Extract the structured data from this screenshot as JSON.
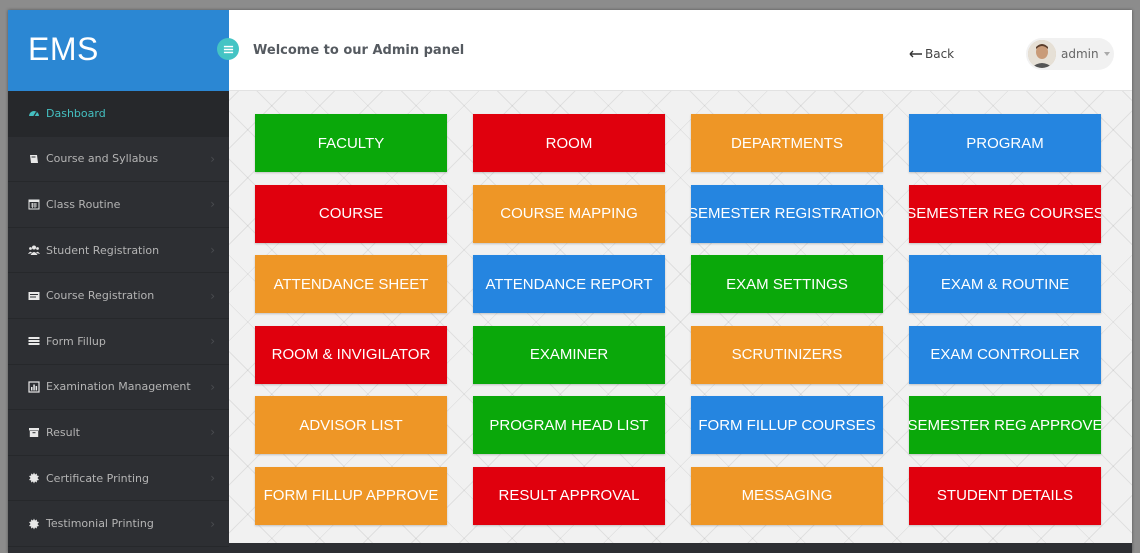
{
  "brand": "EMS",
  "header": {
    "welcome": "Welcome to our Admin panel",
    "back_label": "Back",
    "user_name": "admin"
  },
  "sidebar": {
    "items": [
      {
        "label": "Dashboard",
        "icon": "dashboard-icon",
        "active": true
      },
      {
        "label": "Course and Syllabus",
        "icon": "book-icon"
      },
      {
        "label": "Class Routine",
        "icon": "calendar-icon"
      },
      {
        "label": "Student Registration",
        "icon": "users-icon"
      },
      {
        "label": "Course Registration",
        "icon": "id-card-icon"
      },
      {
        "label": "Form Fillup",
        "icon": "list-icon"
      },
      {
        "label": "Examination Management",
        "icon": "bar-chart-icon"
      },
      {
        "label": "Result",
        "icon": "archive-icon"
      },
      {
        "label": "Certificate Printing",
        "icon": "certificate-icon"
      },
      {
        "label": "Testimonial Printing",
        "icon": "certificate-icon"
      }
    ]
  },
  "colors": {
    "green": "#0aa80a",
    "red": "#e0000d",
    "orange": "#ee9626",
    "blue": "#2585e0"
  },
  "tiles": [
    {
      "label": "FACULTY",
      "color": "green"
    },
    {
      "label": "ROOM",
      "color": "red"
    },
    {
      "label": "DEPARTMENTS",
      "color": "orange"
    },
    {
      "label": "PROGRAM",
      "color": "blue"
    },
    {
      "label": "COURSE",
      "color": "red"
    },
    {
      "label": "COURSE MAPPING",
      "color": "orange"
    },
    {
      "label": "SEMESTER REGISTRATION",
      "color": "blue"
    },
    {
      "label": "SEMESTER REG COURSES",
      "color": "red"
    },
    {
      "label": "ATTENDANCE SHEET",
      "color": "orange"
    },
    {
      "label": "ATTENDANCE REPORT",
      "color": "blue"
    },
    {
      "label": "EXAM SETTINGS",
      "color": "green"
    },
    {
      "label": "EXAM & ROUTINE",
      "color": "blue"
    },
    {
      "label": "ROOM & INVIGILATOR",
      "color": "red"
    },
    {
      "label": "EXAMINER",
      "color": "green"
    },
    {
      "label": "SCRUTINIZERS",
      "color": "orange"
    },
    {
      "label": "EXAM CONTROLLER",
      "color": "blue"
    },
    {
      "label": "ADVISOR LIST",
      "color": "orange"
    },
    {
      "label": "PROGRAM HEAD LIST",
      "color": "green"
    },
    {
      "label": "FORM FILLUP COURSES",
      "color": "blue"
    },
    {
      "label": "SEMESTER REG APPROVE",
      "color": "green"
    },
    {
      "label": "FORM FILLUP APPROVE",
      "color": "orange"
    },
    {
      "label": "RESULT APPROVAL",
      "color": "red"
    },
    {
      "label": "MESSAGING",
      "color": "orange"
    },
    {
      "label": "STUDENT DETAILS",
      "color": "red"
    }
  ]
}
